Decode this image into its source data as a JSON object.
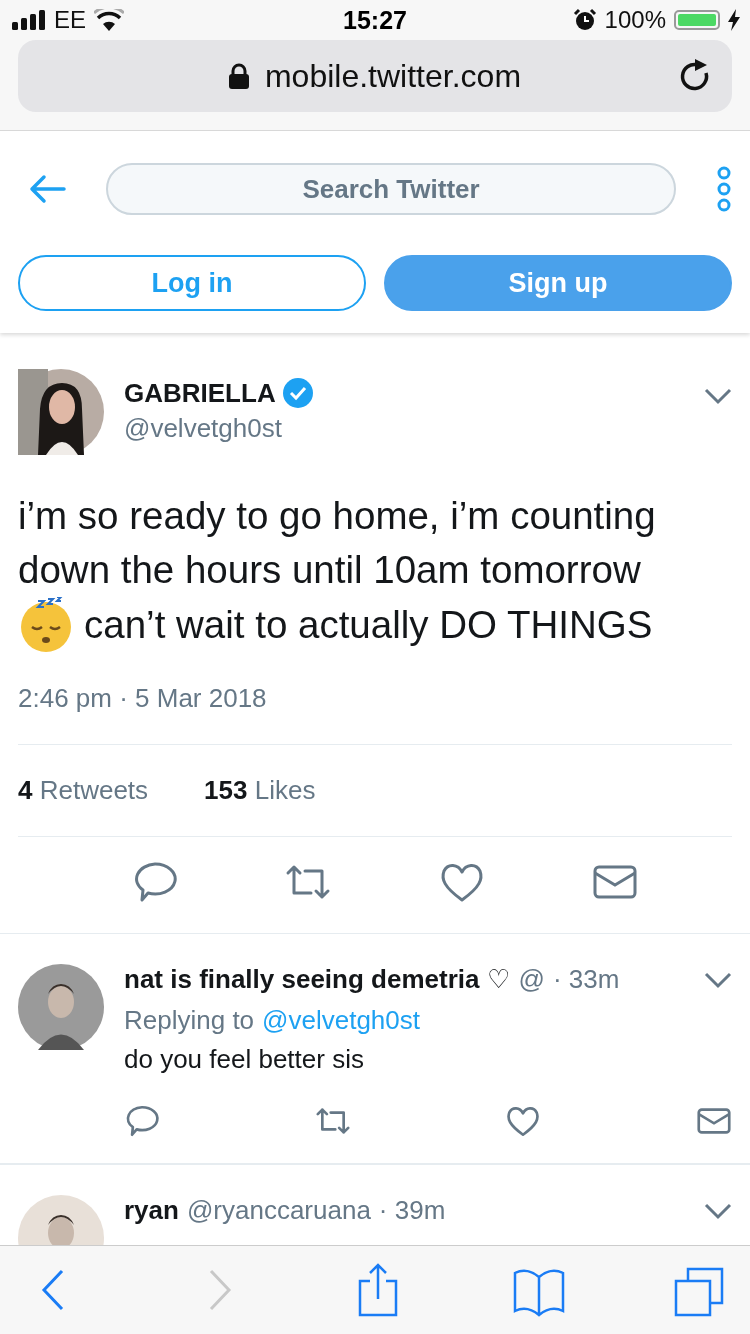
{
  "status_bar": {
    "carrier": "EE",
    "time": "15:27",
    "battery": "100%"
  },
  "browser": {
    "url": "mobile.twitter.com"
  },
  "header": {
    "search": {
      "placeholder": "Search Twitter"
    },
    "login": "Log in",
    "signup": "Sign up"
  },
  "tweet": {
    "name": "GABRIELLA",
    "handle": "@velvetgh0st",
    "text_before": "i’m so ready to go home, i’m counting down the hours until 10am tomorrow",
    "text_after": "can’t wait to actually DO THINGS",
    "timestamp": "2:46 pm · 5 Mar 2018",
    "stats": [
      {
        "count": "4",
        "label": "Retweets"
      },
      {
        "count": "153",
        "label": "Likes"
      }
    ]
  },
  "replies": [
    {
      "name": "nat is finally seeing demetria",
      "name_suffix": "♡",
      "handle": "@",
      "time": "· 33m",
      "replying_label": "Replying to",
      "reply_to": "@velvetgh0st",
      "text": "do you feel better sis"
    },
    {
      "name": "ryan",
      "handle": "@ryanccaruana",
      "time": "· 39m"
    }
  ],
  "toolbar": [
    {
      "kind": "back",
      "disabled": false
    },
    {
      "kind": "forward",
      "disabled": true
    },
    {
      "kind": "share",
      "disabled": false
    },
    {
      "kind": "bookmarks",
      "disabled": false
    },
    {
      "kind": "tabs",
      "disabled": false
    }
  ]
}
